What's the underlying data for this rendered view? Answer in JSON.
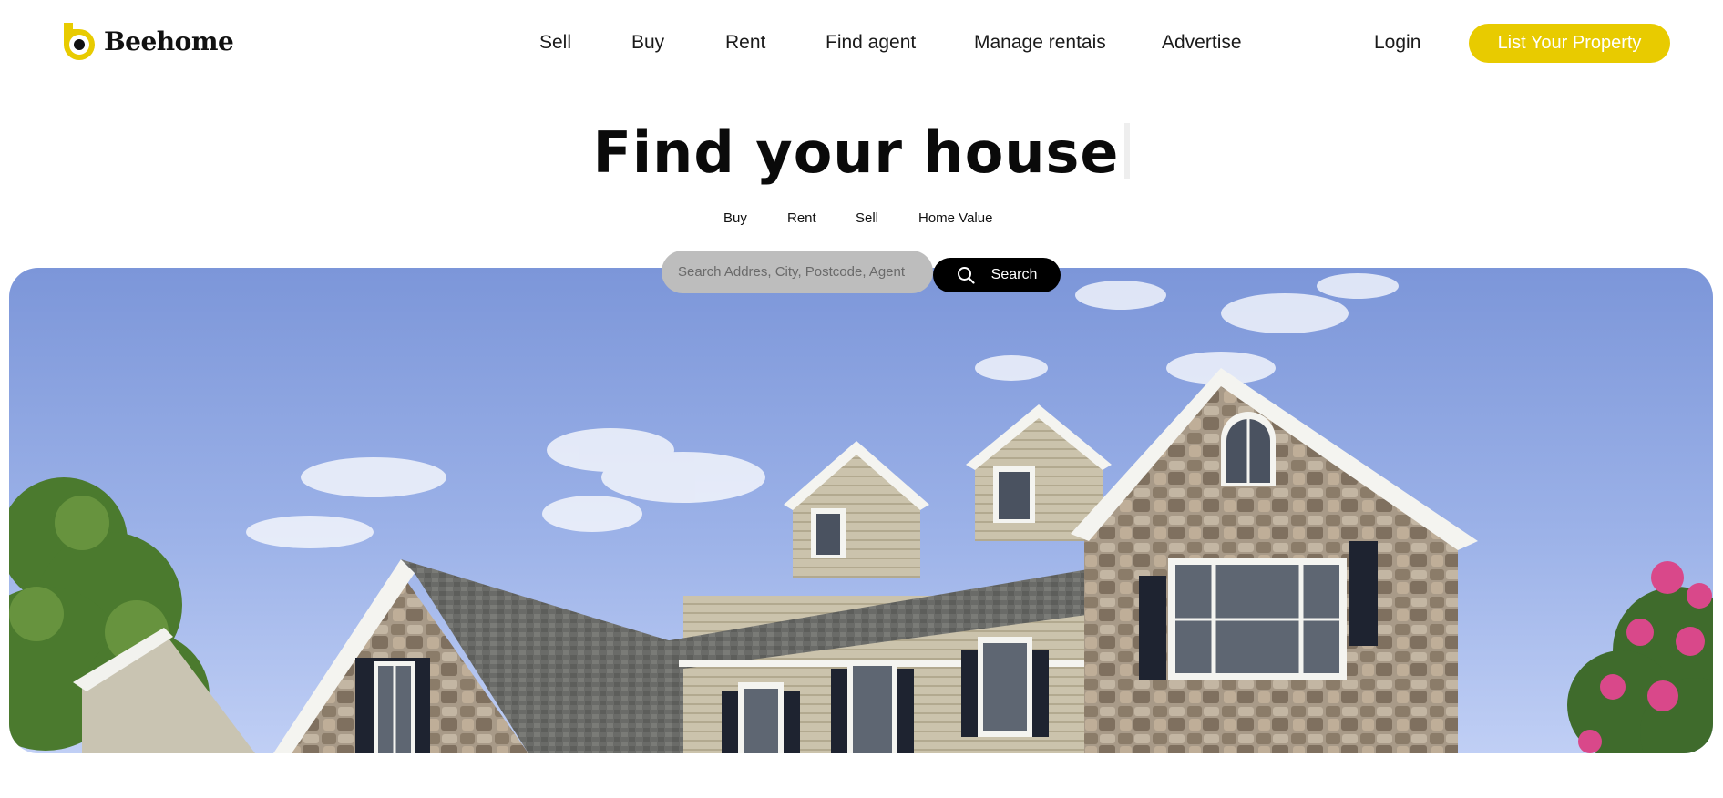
{
  "brand": {
    "name": "Beehome",
    "accent_color": "#e8cb00"
  },
  "nav": {
    "items": [
      "Sell",
      "Buy",
      "Rent",
      "Find agent",
      "Manage rentais",
      "Advertise"
    ]
  },
  "header": {
    "login_label": "Login",
    "list_property_label": "List Your Property"
  },
  "hero": {
    "title": "Find your house"
  },
  "search": {
    "tabs": [
      "Buy",
      "Rent",
      "Sell",
      "Home Value"
    ],
    "placeholder": "Search Addres, City, Postcode, Agent",
    "button_label": "Search",
    "button_icon": "search-icon"
  },
  "hero_image": {
    "subject": "house-photo"
  }
}
